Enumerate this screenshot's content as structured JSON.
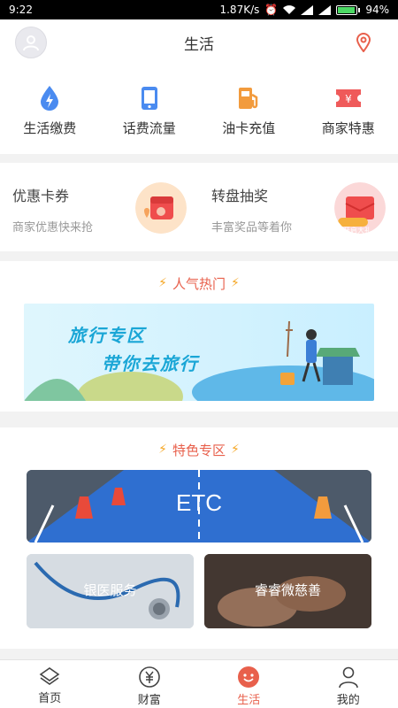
{
  "status_bar": {
    "time": "9:22",
    "network_speed": "1.87K/s",
    "battery": "94%"
  },
  "header": {
    "title": "生活"
  },
  "quick_actions": [
    {
      "label": "生活缴费",
      "icon": "water-drop-bolt-icon",
      "color": "#4a8bf0"
    },
    {
      "label": "话费流量",
      "icon": "phone-icon",
      "color": "#4a8bf0"
    },
    {
      "label": "油卡充值",
      "icon": "fuel-pump-icon",
      "color": "#f29b3d"
    },
    {
      "label": "商家特惠",
      "icon": "ticket-yen-icon",
      "color": "#ef5a5a"
    }
  ],
  "promos": [
    {
      "title": "优惠卡券",
      "subtitle": "商家优惠快来抢"
    },
    {
      "title": "转盘抽奖",
      "subtitle": "丰富奖品等着你",
      "art_text": "开启大礼"
    }
  ],
  "hot": {
    "title": "人气热门",
    "banner_line1": "旅行专区",
    "banner_line2": "带你去旅行"
  },
  "special": {
    "title": "特色专区",
    "etc_label": "ETC",
    "card1_label": "银医服务",
    "card2_label": "睿睿微慈善"
  },
  "tabs": [
    {
      "label": "首页",
      "icon": "home-icon",
      "active": false
    },
    {
      "label": "财富",
      "icon": "yen-coin-icon",
      "active": false
    },
    {
      "label": "生活",
      "icon": "smile-icon",
      "active": true
    },
    {
      "label": "我的",
      "icon": "person-icon",
      "active": false
    }
  ],
  "colors": {
    "accent": "#e8604c",
    "bolt": "#f5a623"
  }
}
